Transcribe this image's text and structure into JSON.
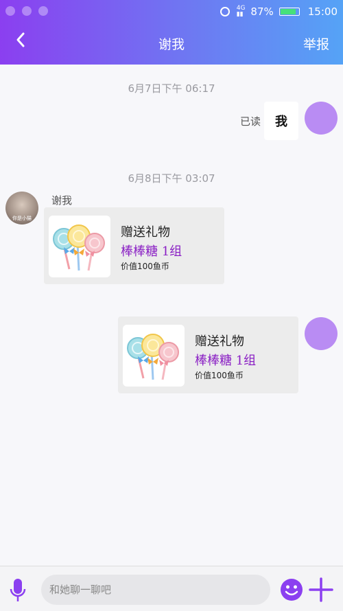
{
  "status_bar": {
    "battery": "87%",
    "time": "15:00"
  },
  "header": {
    "title": "谢我",
    "report": "举报"
  },
  "messages": {
    "time1": "6月7日下午 06:17",
    "read_label": "已读",
    "text1": "我",
    "time2": "6月8日下午 03:07",
    "sender_name": "谢我",
    "avatar_caption": "你是小猫",
    "gift_received": {
      "title": "赠送礼物",
      "item": "棒棒糖 1组",
      "value": "价值100鱼币"
    },
    "gift_sent": {
      "title": "赠送礼物",
      "item": "棒棒糖 1组",
      "value": "价值100鱼币"
    }
  },
  "input": {
    "placeholder": "和她聊一聊吧",
    "value": ""
  },
  "icons": [
    "back-icon",
    "mic-icon",
    "emoji-icon",
    "plus-icon",
    "alarm-icon",
    "signal-icon",
    "battery-icon",
    "lollipop-icon"
  ],
  "colors": {
    "accent": "#8b3ff0",
    "gift_item": "#8a1fc4",
    "header_gradient_end": "#55a3f6"
  }
}
